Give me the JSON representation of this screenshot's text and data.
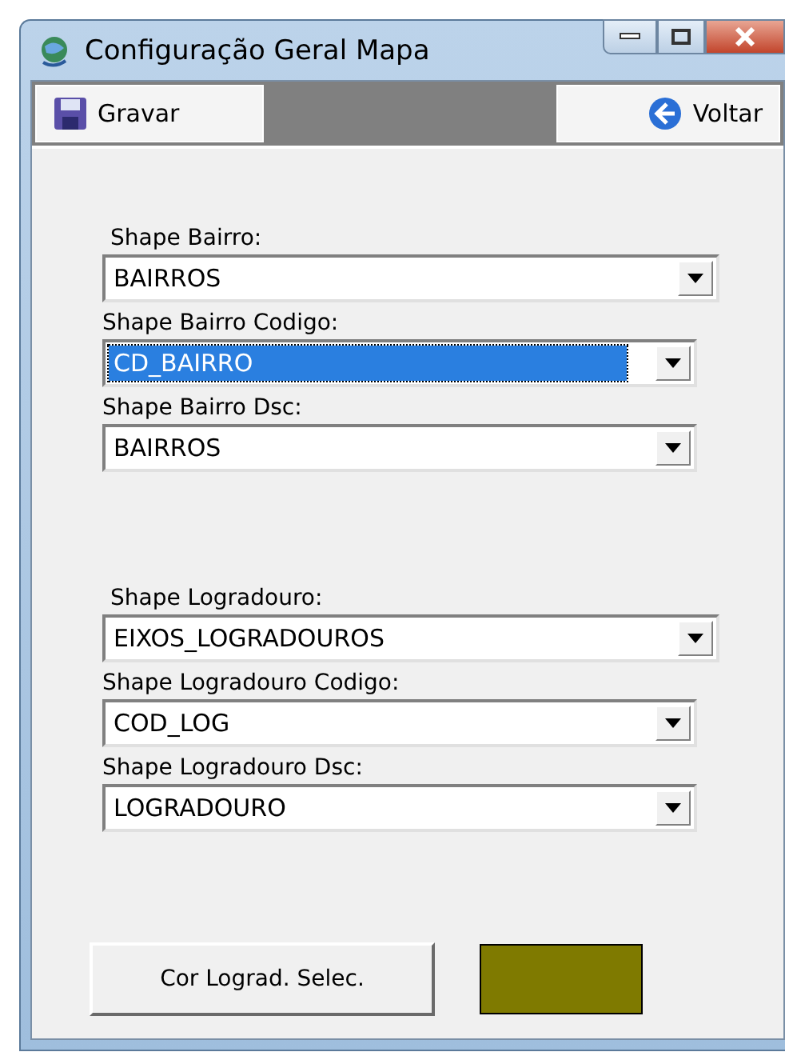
{
  "window": {
    "title": "Configuração Geral Mapa"
  },
  "toolbar": {
    "buttons": [
      {
        "kind": "save",
        "label": "Gravar"
      },
      {
        "kind": "back",
        "label": "Voltar"
      }
    ]
  },
  "groups": [
    {
      "fields": [
        {
          "label": "Shape Bairro:",
          "value": "BAIRROS",
          "selected": false,
          "wide": true
        },
        {
          "label": "Shape Bairro Codigo:",
          "value": "CD_BAIRRO",
          "selected": true,
          "wide": false
        },
        {
          "label": "Shape Bairro Dsc:",
          "value": "BAIRROS",
          "selected": false,
          "wide": false
        }
      ]
    },
    {
      "fields": [
        {
          "label": "Shape Logradouro:",
          "value": "EIXOS_LOGRADOUROS",
          "selected": false,
          "wide": true
        },
        {
          "label": "Shape Logradouro Codigo:",
          "value": "COD_LOG",
          "selected": false,
          "wide": false
        },
        {
          "label": "Shape Logradouro Dsc:",
          "value": "LOGRADOURO",
          "selected": false,
          "wide": false
        }
      ]
    }
  ],
  "color_picker": {
    "button": "Cor Lograd. Selec.",
    "color": "#7f7a00"
  }
}
